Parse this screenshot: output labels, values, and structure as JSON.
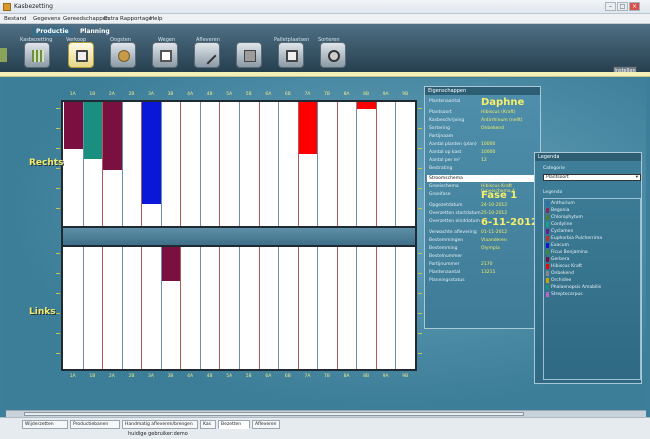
{
  "window": {
    "title": "Kasbezetting"
  },
  "menu": [
    "Bestand",
    "Gegevens",
    "Gereedschappen",
    "Extra",
    "Rapportage",
    "Help"
  ],
  "ribbon": {
    "tabs": [
      "Productie",
      "Planning"
    ],
    "groups": [
      "Kasbezetting",
      "Verkoop",
      "Oogsten",
      "Wegen",
      "Afleveren",
      "Palletplaatsen",
      "Sorteren"
    ],
    "buttons": [
      "seed-tray",
      "pot-plant",
      "seed",
      "pot",
      "needle",
      "boxes",
      "screen",
      "disc"
    ],
    "right_button": "Instellen"
  },
  "bench": {
    "top_label": "Rechts",
    "bottom_label": "Links",
    "columns": [
      "1A",
      "1B",
      "2A",
      "2B",
      "3A",
      "3B",
      "4A",
      "4B",
      "5A",
      "5B",
      "6A",
      "6B",
      "7A",
      "7B",
      "8A",
      "8B",
      "9A",
      "9B"
    ],
    "top_bars": [
      {
        "col": 0,
        "fill": 0.38,
        "color": "#7a1040"
      },
      {
        "col": 1,
        "fill": 0.46,
        "color": "#1a8f7f"
      },
      {
        "col": 2,
        "fill": 0.55,
        "color": "#7a1040"
      },
      {
        "col": 4,
        "fill": 0.82,
        "color": "#0b17d8"
      },
      {
        "col": 12,
        "fill": 0.42,
        "color": "#ff0000"
      },
      {
        "col": 15,
        "fill": 0.06,
        "color": "#ff0000"
      }
    ],
    "bottom_bars": [
      {
        "col": 5,
        "fill": 0.28,
        "color": "#7a1040"
      }
    ]
  },
  "properties": {
    "title": "Eigenschappen",
    "rows": [
      {
        "label": "Plantenaantal",
        "value": "Daphne",
        "big": true
      },
      {
        "label": "Plantsoort",
        "value": "Hibiscus (Kraft)"
      },
      {
        "label": "Kasbeschrijving",
        "value": "Antirrhinum (nellt)"
      },
      {
        "label": "Sortering",
        "value": "Onbekend"
      },
      {
        "label": "Partijnaam",
        "value": ""
      },
      {
        "label": "Aantal planten (plan)",
        "value": "10000"
      },
      {
        "label": "Aantal op kast",
        "value": "10000"
      },
      {
        "label": "Aantal per m²",
        "value": "12"
      },
      {
        "label": "Bestrating",
        "value": ""
      }
    ],
    "section_label": "Stroomschema",
    "rows2": [
      {
        "label": "Groeischema",
        "value": "Hibiscus Kraft Groeischema 4"
      },
      {
        "label": "Groeifase",
        "value": "Fase 1",
        "big": true
      },
      {
        "label": "Opgezetdatum",
        "value": "24-10-2012"
      },
      {
        "label": "Overzetten startdatum",
        "value": "25-10-2012"
      },
      {
        "label": "Overzetten einddatum",
        "value": "6-11-2012",
        "big": true
      },
      {
        "label": "Verwachte aflevering",
        "value": "01-11-2012"
      },
      {
        "label": "Bestemmingen",
        "value": "Vlaanderen"
      },
      {
        "label": "Bestemming",
        "value": "Olympia"
      },
      {
        "label": "Bestelnummer",
        "value": ""
      },
      {
        "label": "Partijnummer",
        "value": "2170"
      },
      {
        "label": "Plantenaantal",
        "value": "13211"
      },
      {
        "label": "Planningsstatus",
        "value": ""
      }
    ]
  },
  "legend": {
    "title": "Legenda",
    "category_label": "Categorie",
    "selected": "Plantsoort",
    "items_label": "Legenda",
    "items": [
      {
        "name": "Anthurium",
        "color": "#2a6fb0"
      },
      {
        "name": "Begonia",
        "color": "#8a2a5a"
      },
      {
        "name": "Chlorophytum",
        "color": "#4f7f2a"
      },
      {
        "name": "Cordyline",
        "color": "#1a9f8a"
      },
      {
        "name": "Cyclamen",
        "color": "#6a1a8f"
      },
      {
        "name": "Euphorbia Pulcherrima",
        "color": "#c0302a"
      },
      {
        "name": "Exacum",
        "color": "#0b17d8"
      },
      {
        "name": "Ficus Benjamina",
        "color": "#3a8a3a"
      },
      {
        "name": "Gerbera",
        "color": "#7a1040"
      },
      {
        "name": "Hibiscus Kraft",
        "color": "#ff0000"
      },
      {
        "name": "Onbekend",
        "color": "#888888"
      },
      {
        "name": "Orchidee",
        "color": "#d0a000"
      },
      {
        "name": "Phalaenopsis Amabilis",
        "color": "#1a8f7f"
      },
      {
        "name": "Streptocarpus",
        "color": "#c060d0"
      }
    ]
  },
  "status": {
    "tabs": [
      "Wijderzetten",
      "Productiebanen",
      "Handmatig afleveren/brengen",
      "Kas",
      "Bezetten",
      "Afleveren"
    ],
    "active_tab": 4,
    "user": "huidige gebruiker:demo"
  }
}
